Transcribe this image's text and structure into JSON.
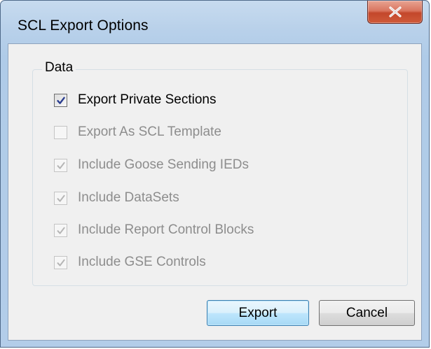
{
  "window": {
    "title": "SCL Export Options"
  },
  "group": {
    "label": "Data",
    "options": [
      {
        "label": "Export Private Sections",
        "checked": true,
        "enabled": true
      },
      {
        "label": "Export As SCL Template",
        "checked": false,
        "enabled": false
      },
      {
        "label": "Include Goose Sending IEDs",
        "checked": true,
        "enabled": false
      },
      {
        "label": "Include DataSets",
        "checked": true,
        "enabled": false
      },
      {
        "label": "Include Report Control Blocks",
        "checked": true,
        "enabled": false
      },
      {
        "label": "Include GSE Controls",
        "checked": true,
        "enabled": false
      }
    ]
  },
  "buttons": {
    "export_label": "Export",
    "cancel_label": "Cancel"
  },
  "icons": {
    "close": "close-icon",
    "check": "checkmark-icon"
  },
  "colors": {
    "close_button": "#c3472b",
    "checkmark_enabled": "#2a3d8f",
    "checkmark_disabled": "#b5b5b5",
    "disabled_text": "#8d8d8d"
  }
}
